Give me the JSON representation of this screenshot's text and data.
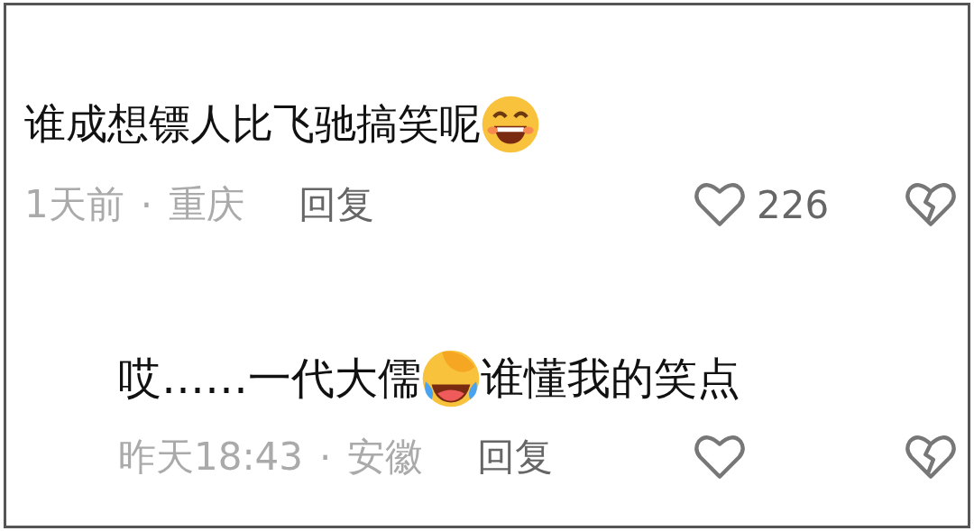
{
  "comments": [
    {
      "kind": "comment",
      "segments": [
        {
          "kind": "text",
          "text": "谁成想镖人比飞驰搞笑呢"
        },
        {
          "kind": "grin"
        }
      ],
      "time": "1天前",
      "separator": "·",
      "location": "重庆",
      "reply": "回复",
      "likes": "226"
    },
    {
      "kind": "reply",
      "segments": [
        {
          "kind": "text",
          "text": "哎……一代大儒"
        },
        {
          "kind": "laugh"
        },
        {
          "kind": "text",
          "text": "谁懂我的笑点"
        }
      ],
      "time": "昨天18:43",
      "separator": "·",
      "location": "安徽",
      "reply": "回复"
    }
  ]
}
